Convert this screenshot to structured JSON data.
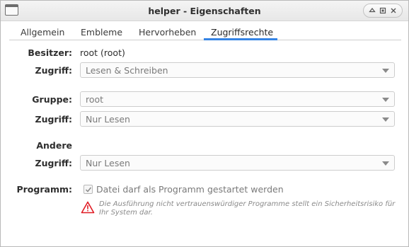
{
  "window": {
    "title": "helper - Eigenschaften",
    "icon": "window-icon",
    "controls": [
      "up-icon",
      "maximize-icon",
      "close-icon"
    ]
  },
  "tabs": [
    {
      "label": "Allgemein",
      "active": false
    },
    {
      "label": "Embleme",
      "active": false
    },
    {
      "label": "Hervorheben",
      "active": false
    },
    {
      "label": "Zugriffsrechte",
      "active": true
    }
  ],
  "owner": {
    "label": "Besitzer:",
    "value": "root (root)",
    "access_label": "Zugriff:",
    "access_value": "Lesen & Schreiben"
  },
  "group": {
    "label": "Gruppe:",
    "value": "root",
    "access_label": "Zugriff:",
    "access_value": "Nur Lesen"
  },
  "others": {
    "label": "Andere",
    "access_label": "Zugriff:",
    "access_value": "Nur Lesen"
  },
  "program": {
    "label": "Programm:",
    "checkbox_label": "Datei darf als Programm gestartet werden",
    "checked": true,
    "warning": "Die Ausführung nicht vertrauenswürdiger Programme stellt ein Sicherheitsrisiko für Ihr System dar."
  },
  "colors": {
    "accent": "#3584e4",
    "warning": "#e01b24"
  }
}
